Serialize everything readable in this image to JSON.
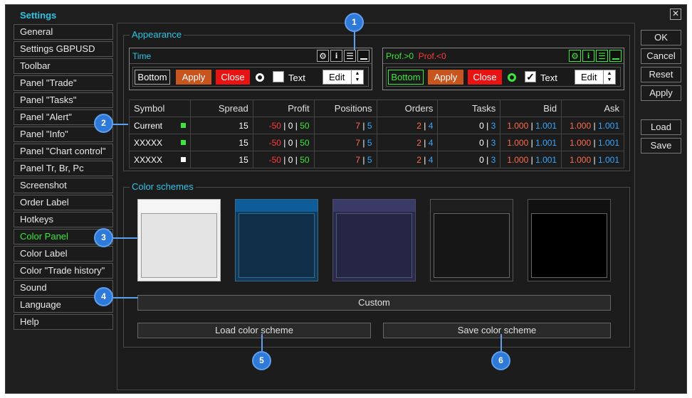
{
  "window": {
    "title": "Settings",
    "close_glyph": "✕"
  },
  "sidebar": {
    "items": [
      {
        "label": "General"
      },
      {
        "label": "Settings GBPUSD"
      },
      {
        "label": "Toolbar"
      },
      {
        "label": "Panel \"Trade\""
      },
      {
        "label": "Panel \"Tasks\""
      },
      {
        "label": "Panel \"Alert\""
      },
      {
        "label": "Panel \"Info\""
      },
      {
        "label": "Panel \"Chart control\""
      },
      {
        "label": "Panel Tr, Br, Pc"
      },
      {
        "label": "Screenshot"
      },
      {
        "label": "Order Label"
      },
      {
        "label": "Hotkeys"
      },
      {
        "label": "Color Panel",
        "active": true
      },
      {
        "label": "Color Label"
      },
      {
        "label": "Color \"Trade history\""
      },
      {
        "label": "Sound"
      },
      {
        "label": "Language"
      },
      {
        "label": "Help"
      }
    ]
  },
  "appearance": {
    "title": "Appearance",
    "left_panel": {
      "title": "Time",
      "bottom_label": "Bottom",
      "apply_label": "Apply",
      "close_label": "Close",
      "text_label": "Text",
      "edit_label": "Edit"
    },
    "right_panel": {
      "title_pos": "Prof.>0",
      "title_neg": "Prof.<0",
      "bottom_label": "Bottom",
      "apply_label": "Apply",
      "close_label": "Close",
      "text_label": "Text",
      "edit_label": "Edit",
      "check_glyph": "✓"
    }
  },
  "table": {
    "headers": [
      "Symbol",
      "Spread",
      "Profit",
      "Positions",
      "Orders",
      "Tasks",
      "Bid",
      "Ask"
    ],
    "rows": [
      {
        "symbol": "Current",
        "spread": "15",
        "profit": [
          "-50",
          "0",
          "50"
        ],
        "positions": [
          "7",
          "5"
        ],
        "orders": [
          "2",
          "4"
        ],
        "tasks": [
          "0",
          "3"
        ],
        "bid": [
          "1.000",
          "1.001"
        ],
        "ask": [
          "1.000",
          "1.001"
        ]
      },
      {
        "symbol": "XXXXX",
        "spread": "15",
        "profit": [
          "-50",
          "0",
          "50"
        ],
        "positions": [
          "7",
          "5"
        ],
        "orders": [
          "2",
          "4"
        ],
        "tasks": [
          "0",
          "3"
        ],
        "bid": [
          "1.000",
          "1.001"
        ],
        "ask": [
          "1.000",
          "1.001"
        ]
      },
      {
        "symbol": "XXXXX",
        "spread": "15",
        "profit": [
          "-50",
          "0",
          "50"
        ],
        "positions": [
          "7",
          "5"
        ],
        "orders": [
          "2",
          "4"
        ],
        "tasks": [
          "0",
          "3"
        ],
        "bid": [
          "1.000",
          "1.001"
        ],
        "ask": [
          "1.000",
          "1.001"
        ]
      }
    ],
    "separator": "|"
  },
  "color_schemes": {
    "title": "Color schemes",
    "custom_label": "Custom",
    "load_label": "Load color scheme",
    "save_label": "Save color scheme"
  },
  "right_buttons": {
    "ok": "OK",
    "cancel": "Cancel",
    "reset": "Reset",
    "apply": "Apply",
    "load": "Load",
    "save": "Save"
  },
  "callouts": [
    "1",
    "2",
    "3",
    "4",
    "5",
    "6"
  ],
  "colors": {
    "accent": "#2ec4e6",
    "active_green": "#3ce63c",
    "negative_red": "#ff3b3b",
    "callout_blue": "#2f7ad8"
  }
}
